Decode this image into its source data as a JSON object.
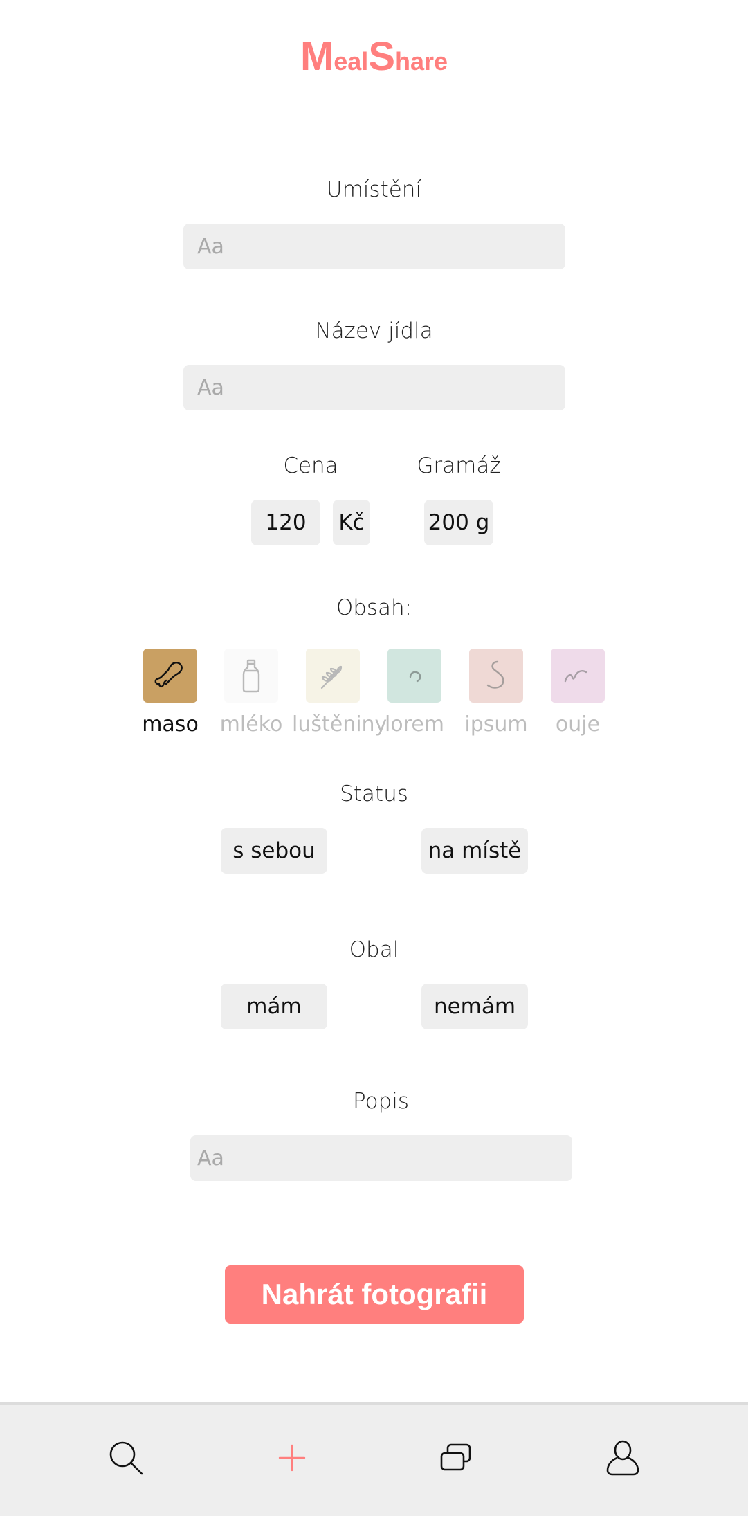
{
  "app": {
    "logo_m": "M",
    "logo_eal": "eal",
    "logo_s": "S",
    "logo_hare": "hare",
    "accent_color": "#ff7f7e"
  },
  "form": {
    "location": {
      "label": "Umístění",
      "placeholder": "Aa",
      "value": ""
    },
    "meal_name": {
      "label": "Název jídla",
      "placeholder": "Aa",
      "value": ""
    },
    "price": {
      "label": "Cena",
      "value": "120",
      "currency": "Kč"
    },
    "weight": {
      "label": "Gramáž",
      "value": "200 g"
    },
    "contents": {
      "label": "Obsah:",
      "items": [
        {
          "label": "maso",
          "icon": "drumstick-icon",
          "color": "#c9a063",
          "selected": true
        },
        {
          "label": "mléko",
          "icon": "milk-bottle-icon",
          "color": "#fafafa",
          "selected": false
        },
        {
          "label": "luštěniny",
          "icon": "grain-icon",
          "color": "#f6f3e6",
          "selected": false
        },
        {
          "label": "lorem",
          "icon": "curl-icon",
          "color": "#d1e6df",
          "selected": false
        },
        {
          "label": "ipsum",
          "icon": "hook-icon",
          "color": "#efd9d5",
          "selected": false
        },
        {
          "label": "ouje",
          "icon": "wave-icon",
          "color": "#efdbea",
          "selected": false
        }
      ]
    },
    "status": {
      "label": "Status",
      "options": [
        "s sebou",
        "na místě"
      ]
    },
    "packaging": {
      "label": "Obal",
      "options": [
        "mám",
        "nemám"
      ]
    },
    "description": {
      "label": "Popis",
      "placeholder": "Aa",
      "value": ""
    },
    "upload_button": "Nahrát fotografii"
  },
  "bottom_nav": {
    "items": [
      {
        "icon": "search-icon"
      },
      {
        "icon": "plus-icon",
        "active": true
      },
      {
        "icon": "cards-icon"
      },
      {
        "icon": "user-icon"
      }
    ]
  }
}
